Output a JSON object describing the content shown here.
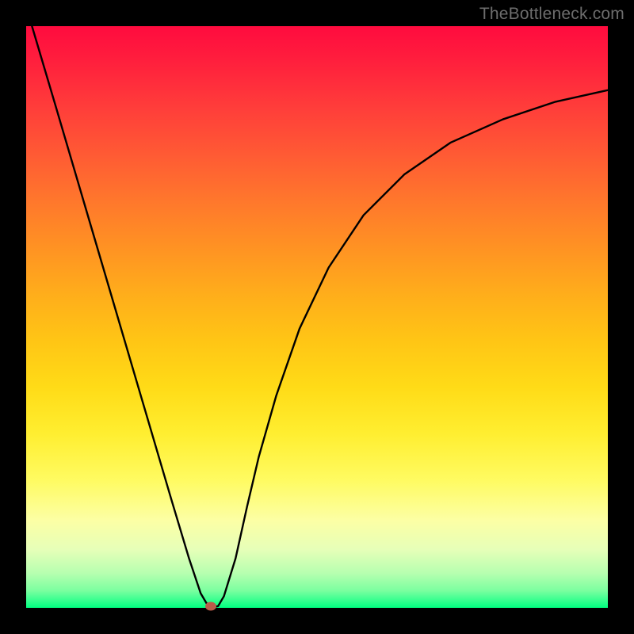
{
  "watermark": "TheBottleneck.com",
  "chart_data": {
    "type": "line",
    "title": "",
    "xlabel": "",
    "ylabel": "",
    "xlim": [
      0,
      100
    ],
    "ylim": [
      0,
      100
    ],
    "series": [
      {
        "name": "curve",
        "x": [
          1,
          5,
          10,
          15,
          20,
          25,
          28,
          30,
          31,
          32,
          33,
          34,
          36,
          38,
          40,
          43,
          47,
          52,
          58,
          65,
          73,
          82,
          91,
          100
        ],
        "y": [
          100,
          86.5,
          69.5,
          52.5,
          35.5,
          18.5,
          8.5,
          2.5,
          0.8,
          0.1,
          0.3,
          2.0,
          8.5,
          17.5,
          26.0,
          36.5,
          48.0,
          58.5,
          67.5,
          74.5,
          80.0,
          84.0,
          87.0,
          89.0
        ]
      }
    ],
    "marker": {
      "x": 31.7,
      "y": 0.3
    },
    "gradient_stops": [
      {
        "pos": 0,
        "color": "#ff0b3e"
      },
      {
        "pos": 50,
        "color": "#ffbd17"
      },
      {
        "pos": 80,
        "color": "#fffb61"
      },
      {
        "pos": 100,
        "color": "#00ff80"
      }
    ]
  }
}
